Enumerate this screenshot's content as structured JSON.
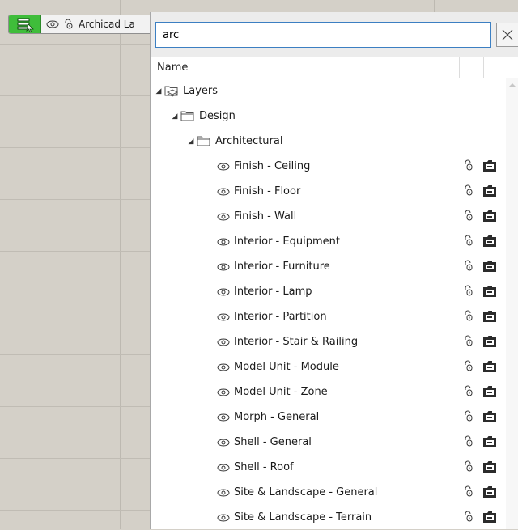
{
  "toolbar": {
    "layer_label": "Archicad La"
  },
  "search": {
    "value": "arc"
  },
  "columns": {
    "name": "Name"
  },
  "tree": {
    "root": "Layers",
    "group": "Design",
    "subgroup": "Architectural",
    "layers": [
      "Finish - Ceiling",
      "Finish - Floor",
      "Finish - Wall",
      "Interior - Equipment",
      "Interior - Furniture",
      "Interior - Lamp",
      "Interior - Partition",
      "Interior - Stair & Railing",
      "Model Unit - Module",
      "Model Unit - Zone",
      "Morph - General",
      "Shell - General",
      "Shell - Roof",
      "Site & Landscape - General",
      "Site & Landscape - Terrain"
    ]
  },
  "colors": {
    "layer_button": "#3fbd3a",
    "search_border": "#3c7fc2"
  },
  "icons": {
    "visibility": "eye-icon",
    "lock": "lock-open-icon",
    "layer_3d": "layer-3d-icon",
    "folder": "folder-icon",
    "layers_root": "layers-folder-icon",
    "close": "close-icon"
  }
}
